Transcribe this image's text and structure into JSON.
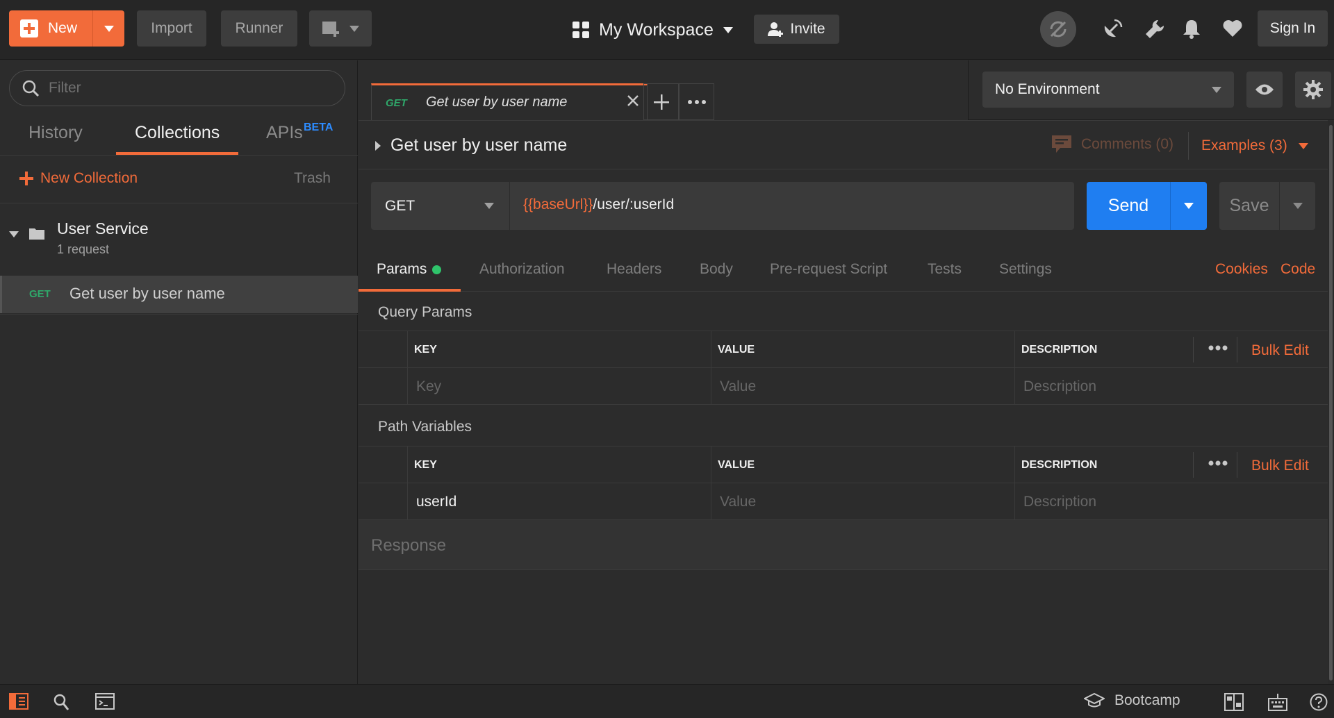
{
  "app": {
    "topbar": {
      "new_label": "New",
      "import_label": "Import",
      "runner_label": "Runner",
      "workspace_label": "My Workspace",
      "invite_label": "Invite",
      "signin_label": "Sign In"
    },
    "sidebar": {
      "filter_placeholder": "Filter",
      "tabs": [
        "History",
        "Collections",
        "APIs"
      ],
      "active_tab": "Collections",
      "apis_badge": "BETA",
      "new_collection_label": "New Collection",
      "trash_label": "Trash",
      "collection": {
        "name": "User Service",
        "count": "1 request",
        "requests": [
          {
            "method": "GET",
            "name": "Get user by user name"
          }
        ]
      }
    },
    "request_tab": {
      "method": "GET",
      "title": "Get user by user name"
    },
    "environment": {
      "selected": "No Environment"
    },
    "request": {
      "title": "Get user by user name",
      "comments_label": "Comments (0)",
      "examples_label": "Examples (3)",
      "method": "GET",
      "url_variable": "{{baseUrl}}",
      "url_path": "/user/:userId",
      "send_label": "Send",
      "save_label": "Save",
      "tabs": [
        "Params",
        "Authorization",
        "Headers",
        "Body",
        "Pre-request Script",
        "Tests",
        "Settings"
      ],
      "active_tab": "Params",
      "cookies_label": "Cookies",
      "code_label": "Code"
    },
    "query_params": {
      "heading": "Query Params",
      "columns": [
        "KEY",
        "VALUE",
        "DESCRIPTION"
      ],
      "bulk_edit_label": "Bulk Edit",
      "placeholder_row": {
        "key": "Key",
        "value": "Value",
        "description": "Description"
      }
    },
    "path_variables": {
      "heading": "Path Variables",
      "columns": [
        "KEY",
        "VALUE",
        "DESCRIPTION"
      ],
      "bulk_edit_label": "Bulk Edit",
      "rows": [
        {
          "key": "userId",
          "value_placeholder": "Value",
          "description_placeholder": "Description"
        }
      ]
    },
    "response": {
      "label": "Response"
    },
    "footer": {
      "bootcamp_label": "Bootcamp"
    },
    "colors": {
      "accent": "#f26b3a",
      "send_blue": "#1f7ef1",
      "get_green": "#2fa86a",
      "background": "#2c2c2c"
    },
    "icons": [
      "plus-icon",
      "caret-down-icon",
      "new-window-icon",
      "grid-icon",
      "add-user-icon",
      "sync-off-icon",
      "satellite-icon",
      "wrench-icon",
      "bell-icon",
      "heart-icon",
      "search-icon",
      "folder-icon",
      "close-icon",
      "more-icon",
      "eye-icon",
      "gear-icon",
      "comment-icon",
      "sidebar-toggle-icon",
      "find-icon",
      "console-icon",
      "graduation-cap-icon",
      "two-pane-icon",
      "keyboard-icon",
      "help-icon"
    ]
  }
}
